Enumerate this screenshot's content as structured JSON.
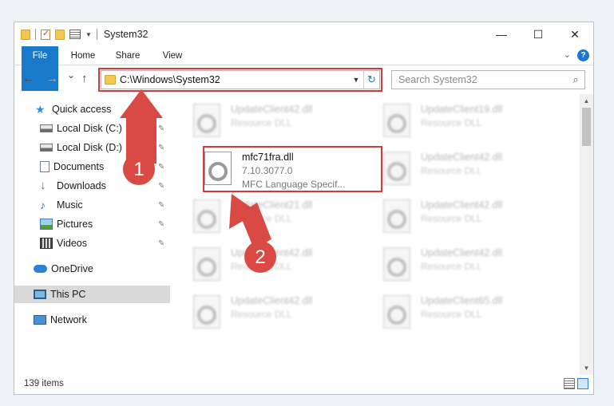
{
  "window": {
    "title": "System32",
    "controls": {
      "minimize": "—",
      "maximize": "☐",
      "close": "✕"
    }
  },
  "ribbon": {
    "tabs": [
      "File",
      "Home",
      "Share",
      "View"
    ],
    "collapse_icon": "chevron-down-icon",
    "help": "?"
  },
  "navbar": {
    "back": "←",
    "forward": "→",
    "recent": "⌄",
    "up": "↑",
    "address": "C:\\Windows\\System32",
    "refresh": "↻",
    "search_placeholder": "Search System32",
    "search_icon": "⌕"
  },
  "nav_pane": {
    "items": [
      {
        "label": "Quick access",
        "icon": "star-icon",
        "pinned": false
      },
      {
        "label": "Local Disk (C:)",
        "icon": "disk-icon",
        "pinned": true
      },
      {
        "label": "Local Disk (D:)",
        "icon": "disk-icon",
        "pinned": true
      },
      {
        "label": "Documents",
        "icon": "document-icon",
        "pinned": true
      },
      {
        "label": "Downloads",
        "icon": "download-icon",
        "pinned": true
      },
      {
        "label": "Music",
        "icon": "music-icon",
        "pinned": true
      },
      {
        "label": "Pictures",
        "icon": "pictures-icon",
        "pinned": true
      },
      {
        "label": "Videos",
        "icon": "videos-icon",
        "pinned": true
      },
      {
        "label": "OneDrive",
        "icon": "cloud-icon",
        "pinned": false
      },
      {
        "label": "This PC",
        "icon": "computer-icon",
        "pinned": false,
        "selected": true
      },
      {
        "label": "Network",
        "icon": "network-icon",
        "pinned": false
      }
    ],
    "pin_glyph": "📌"
  },
  "files": [
    {
      "name": "UpdateClient42.dll",
      "line1": "Resource DLL",
      "line2": ""
    },
    {
      "name": "UpdateClient19.dll",
      "line1": "Resource DLL",
      "line2": ""
    },
    {
      "name": "mfc71fra.dll",
      "line1": "7.10.3077.0",
      "line2": "MFC Language Specif...",
      "focus": true
    },
    {
      "name": "UpdateClient42.dll",
      "line1": "Resource DLL",
      "line2": ""
    },
    {
      "name": "UpdateClient21.dll",
      "line1": "Resource DLL",
      "line2": ""
    },
    {
      "name": "UpdateClient42.dll",
      "line1": "Resource DLL",
      "line2": ""
    },
    {
      "name": "UpdateClient42.dll",
      "line1": "Resource DLL",
      "line2": ""
    },
    {
      "name": "UpdateClient42.dll",
      "line1": "Resource DLL",
      "line2": ""
    },
    {
      "name": "UpdateClient42.dll",
      "line1": "Resource DLL",
      "line2": ""
    },
    {
      "name": "UpdateClient65.dll",
      "line1": "Resource DLL",
      "line2": ""
    }
  ],
  "status": {
    "item_count": "139 items"
  },
  "annotations": {
    "step1": "1",
    "step2": "2",
    "color": "#d33b3b"
  }
}
